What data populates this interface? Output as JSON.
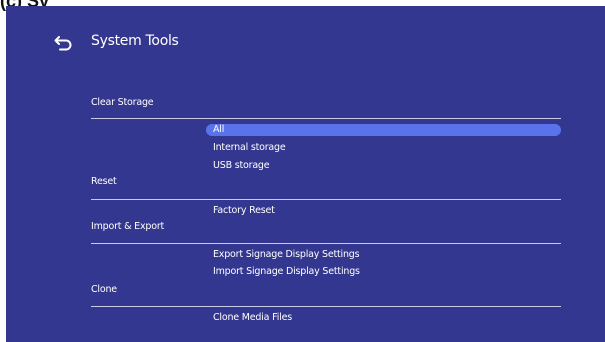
{
  "top_label": "(c) Sy",
  "header": {
    "back_icon": "back-arrow-icon",
    "title": "System Tools"
  },
  "sections": [
    {
      "label": "Clear Storage",
      "options": [
        "All",
        "Internal storage",
        "USB storage"
      ],
      "selected": "All"
    },
    {
      "label": "Reset",
      "options": [
        "Factory Reset"
      ]
    },
    {
      "label": "Import & Export",
      "options": [
        "Export Signage Display Settings",
        "Import Signage Display Settings"
      ]
    },
    {
      "label": "Clone",
      "options": [
        "Clone Media Files"
      ]
    }
  ],
  "colors": {
    "background": "#34378f",
    "highlight": "#5b73ea",
    "divider": "#c9cbe6",
    "text": "#ffffff"
  }
}
